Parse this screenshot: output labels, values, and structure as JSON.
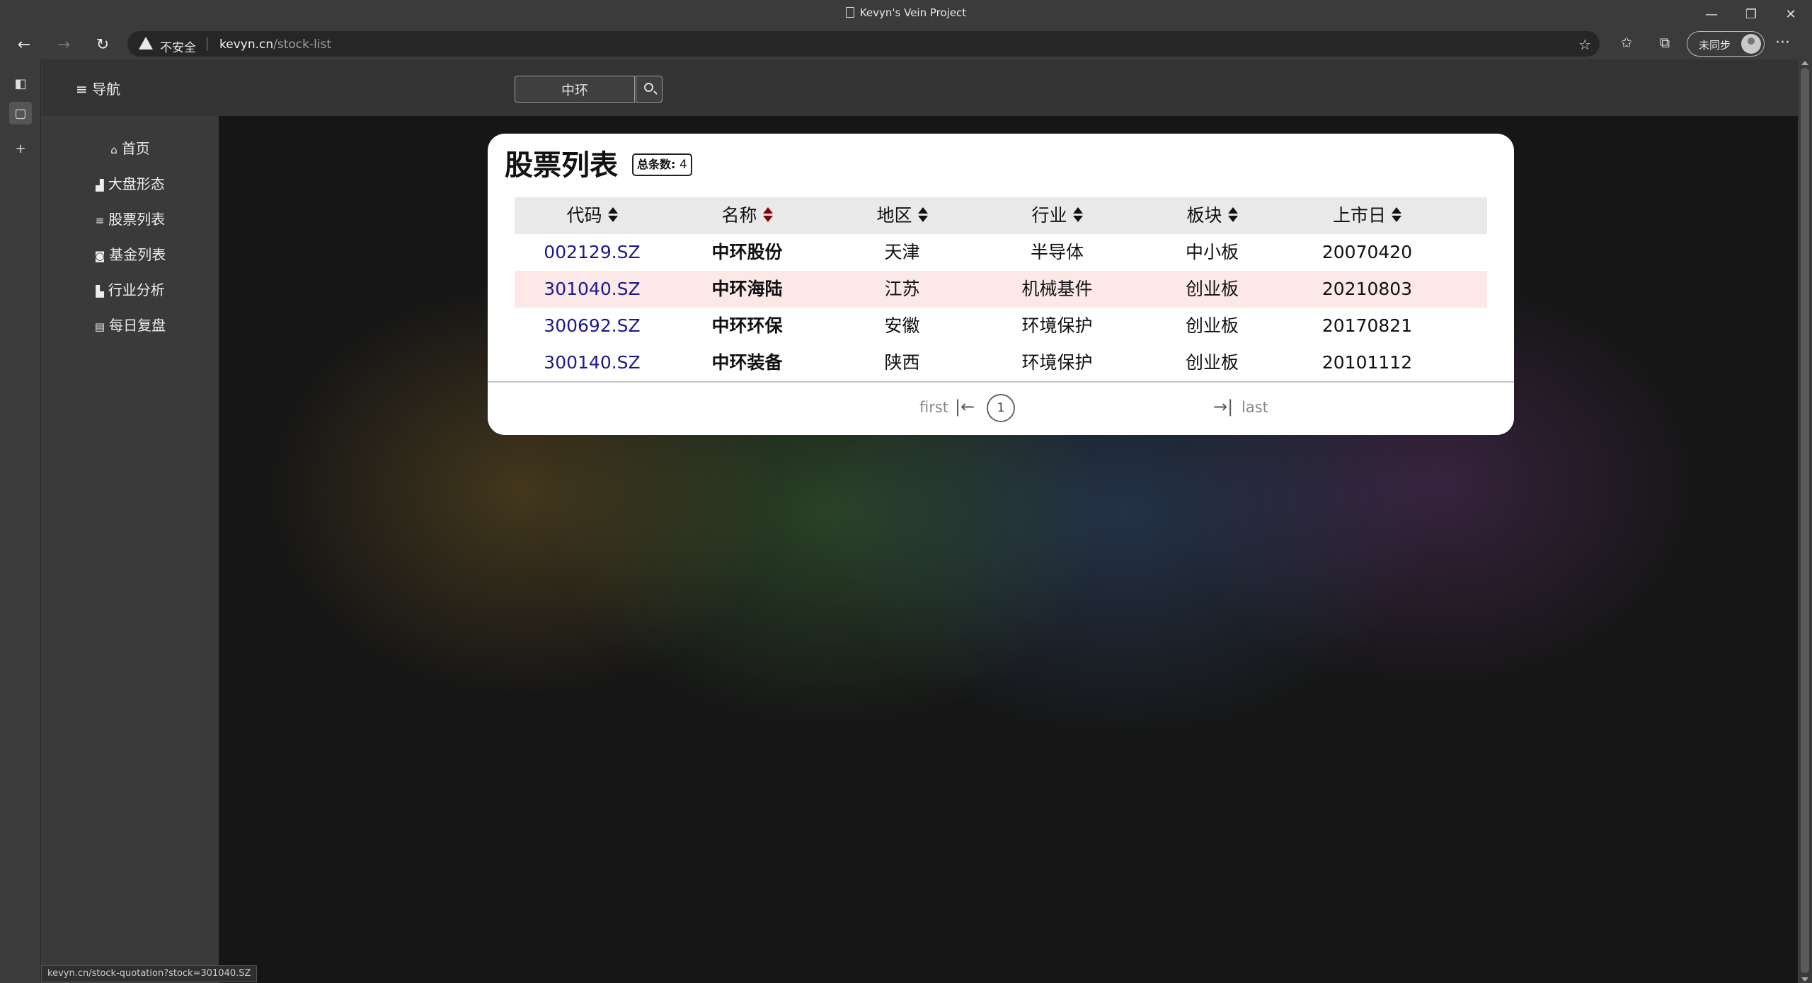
{
  "window": {
    "title": "Kevyn's Vein Project",
    "minimize_icon": "—",
    "restore_icon": "❐",
    "close_icon": "✕"
  },
  "browser": {
    "back_icon": "←",
    "forward_icon": "→",
    "reload_icon": "↻",
    "insecure_label": "不安全",
    "url_host": "kevyn.cn",
    "url_path": "/stock-list",
    "profile_label": "未同步",
    "more_icon": "···",
    "status_url": "kevyn.cn/stock-quotation?stock=301040.SZ"
  },
  "topnav": {
    "nav_toggle": "≡ 导航",
    "search_value": "中环"
  },
  "sidebar": {
    "items": [
      {
        "icon": "⌂",
        "label": "首页"
      },
      {
        "icon": "▟",
        "label": "大盘形态"
      },
      {
        "icon": "≡",
        "label": "股票列表"
      },
      {
        "icon": "◙",
        "label": "基金列表"
      },
      {
        "icon": "▙",
        "label": "行业分析"
      },
      {
        "icon": "▤",
        "label": "每日复盘"
      }
    ]
  },
  "card": {
    "title": "股票列表",
    "count_label": "总条数:",
    "count_value": "4"
  },
  "table": {
    "columns": [
      "代码",
      "名称",
      "地区",
      "行业",
      "板块",
      "上市日"
    ],
    "rows": [
      {
        "code": "002129.SZ",
        "name": "中环股份",
        "region": "天津",
        "industry": "半导体",
        "board": "中小板",
        "date": "20070420"
      },
      {
        "code": "301040.SZ",
        "name": "中环海陆",
        "region": "江苏",
        "industry": "机械基件",
        "board": "创业板",
        "date": "20210803"
      },
      {
        "code": "300692.SZ",
        "name": "中环环保",
        "region": "安徽",
        "industry": "环境保护",
        "board": "创业板",
        "date": "20170821"
      },
      {
        "code": "300140.SZ",
        "name": "中环装备",
        "region": "陕西",
        "industry": "环境保护",
        "board": "创业板",
        "date": "20101112"
      }
    ]
  },
  "pager": {
    "first": "first",
    "first_icon": "|←",
    "page": "1",
    "last_icon": "→|",
    "last": "last"
  },
  "colors": {
    "highlight_row": "#fde8e8",
    "code_link": "#1a1a8c",
    "sort_active": "#8b0000"
  }
}
